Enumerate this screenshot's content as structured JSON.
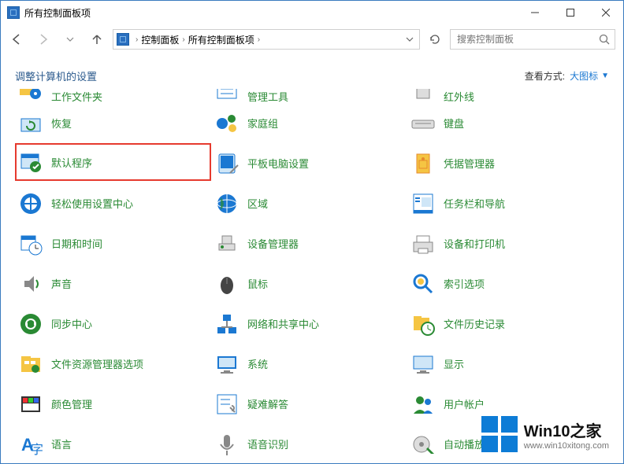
{
  "title": "所有控制面板项",
  "nav": {
    "crumb1": "控制面板",
    "crumb2": "所有控制面板项",
    "search_placeholder": "搜索控制面板"
  },
  "header": {
    "title": "调整计算机的设置",
    "viewmode_label": "查看方式:",
    "viewmode_value": "大图标"
  },
  "items_partial_top": [
    {
      "label": "工作文件夹",
      "icon": "folder-gear-icon"
    },
    {
      "label": "管理工具",
      "icon": "tools-icon"
    },
    {
      "label": "红外线",
      "icon": "server-icon"
    }
  ],
  "items": [
    {
      "label": "恢复",
      "icon": "recovery-icon"
    },
    {
      "label": "家庭组",
      "icon": "homegroup-icon"
    },
    {
      "label": "键盘",
      "icon": "keyboard-icon"
    },
    {
      "label": "默认程序",
      "icon": "default-programs-icon",
      "highlighted": true
    },
    {
      "label": "平板电脑设置",
      "icon": "tablet-icon"
    },
    {
      "label": "凭据管理器",
      "icon": "credential-icon"
    },
    {
      "label": "轻松使用设置中心",
      "icon": "ease-icon"
    },
    {
      "label": "区域",
      "icon": "region-icon"
    },
    {
      "label": "任务栏和导航",
      "icon": "taskbar-icon"
    },
    {
      "label": "日期和时间",
      "icon": "datetime-icon"
    },
    {
      "label": "设备管理器",
      "icon": "device-manager-icon"
    },
    {
      "label": "设备和打印机",
      "icon": "devices-printers-icon"
    },
    {
      "label": "声音",
      "icon": "sound-icon"
    },
    {
      "label": "鼠标",
      "icon": "mouse-icon"
    },
    {
      "label": "索引选项",
      "icon": "indexing-icon"
    },
    {
      "label": "同步中心",
      "icon": "sync-icon"
    },
    {
      "label": "网络和共享中心",
      "icon": "network-icon"
    },
    {
      "label": "文件历史记录",
      "icon": "file-history-icon"
    },
    {
      "label": "文件资源管理器选项",
      "icon": "explorer-options-icon"
    },
    {
      "label": "系统",
      "icon": "system-icon"
    },
    {
      "label": "显示",
      "icon": "display-icon"
    },
    {
      "label": "颜色管理",
      "icon": "color-mgmt-icon"
    },
    {
      "label": "疑难解答",
      "icon": "troubleshoot-icon"
    },
    {
      "label": "用户帐户",
      "icon": "users-icon"
    },
    {
      "label": "语言",
      "icon": "language-icon"
    },
    {
      "label": "语音识别",
      "icon": "speech-icon"
    },
    {
      "label": "自动播放",
      "icon": "autoplay-icon"
    }
  ],
  "watermark": {
    "line1": "Win10之家",
    "line2": "www.win10xitong.com"
  }
}
